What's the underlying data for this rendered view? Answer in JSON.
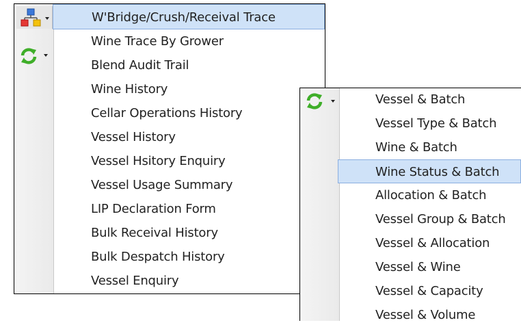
{
  "left_menu": {
    "highlighted_index": 0,
    "items": [
      "W'Bridge/Crush/Receival Trace",
      "Wine Trace By Grower",
      "Blend Audit Trail",
      "Wine History",
      "Cellar Operations History",
      "Vessel History",
      "Vessel Hsitory Enquiry",
      "Vessel Usage Summary",
      "LIP Declaration Form",
      "Bulk Receival History",
      "Bulk Despatch History",
      "Vessel Enquiry"
    ]
  },
  "right_menu": {
    "highlighted_index": 3,
    "items": [
      "Vessel & Batch",
      "Vessel Type & Batch",
      "Wine & Batch",
      "Wine Status & Batch",
      "Allocation & Batch",
      "Vessel Group & Batch",
      "Vessel & Allocation",
      "Vessel & Wine",
      "Vessel & Capacity",
      "Vessel & Volume"
    ]
  },
  "icons": {
    "hierarchy_button": "hierarchy-icon",
    "refresh_button": "refresh-icon",
    "dropdown_caret": "caret-down-icon"
  },
  "colors": {
    "highlight_fill": "#cfe2f8",
    "highlight_border": "#8aaee0",
    "refresh_green": "#3fae29"
  }
}
